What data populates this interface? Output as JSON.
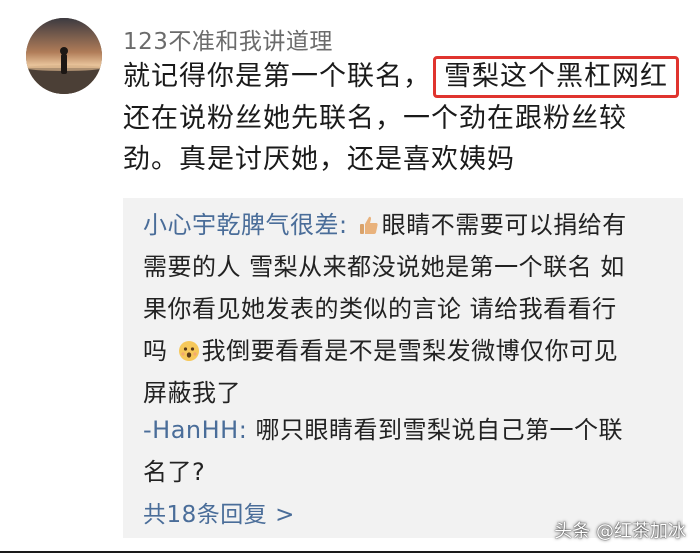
{
  "comment": {
    "username": "123不准和我讲道理",
    "line1_pre": "就记得你是第一个联名，",
    "line1_highlight": "雪梨这个黑杠网红",
    "line2": "还在说粉丝她先联名，一个劲在跟粉丝较",
    "line3": "劲。真是讨厌她，还是喜欢姨妈",
    "highlight_color": "#e0342e"
  },
  "replies": [
    {
      "author": "小心宇乾脾气很差:",
      "emoji_1": "thumbs-up-icon",
      "line1_rest": "眼睛不需要可以捐给有",
      "line2": "需要的人 雪梨从来都没说她是第一个联名 如",
      "line3": "果你看见她发表的类似的言论 请给我看看行",
      "line4_pre": "吗",
      "emoji_2": "surprised-face-icon",
      "line4_rest": "我倒要看看是不是雪梨发微博仅你可见",
      "line5": "屏蔽我了"
    },
    {
      "author": "-HanHH:",
      "line1_rest": "哪只眼睛看到雪梨说自己第一个联",
      "line2": "名了?"
    }
  ],
  "more_replies": "共18条回复 >",
  "watermark": "头条 @红茶加冰",
  "colors": {
    "link": "#4a6d99",
    "reply_background": "#f2f2f2",
    "text": "#1a1a1a",
    "username": "#6b6b6b"
  }
}
